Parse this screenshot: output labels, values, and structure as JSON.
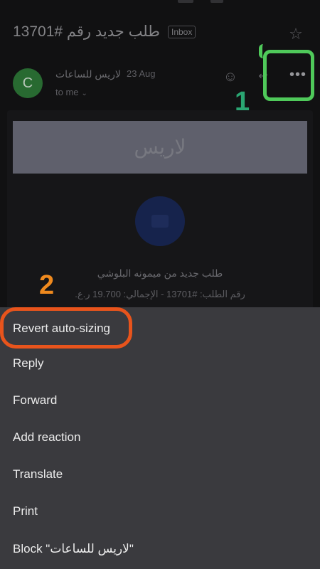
{
  "email": {
    "subject": "طلب جديد رقم #13701",
    "folder_chip": "Inbox",
    "sender": {
      "avatar_letter": "C",
      "name": "لاريس للساعات",
      "date": "23 Aug",
      "to": "to me"
    },
    "body": {
      "banner_text": "لاريس",
      "line1": "طلب جديد من ميمونه البلوشي",
      "line2": "رقم الطلب: #13701 - الإجمالي: 19.700 ر.ع."
    }
  },
  "annotations": {
    "label_1": "1",
    "label_2": "2",
    "green_color": "#4fc95a",
    "orange_color": "#e8541c"
  },
  "menu": {
    "items": [
      "Revert auto-sizing",
      "Reply",
      "Forward",
      "Add reaction",
      "Translate",
      "Print",
      "Block \"لاريس للساعات\""
    ]
  },
  "icons": {
    "star": "star-icon",
    "emoji": "emoji-icon",
    "reply": "reply-icon",
    "more": "more-options-icon"
  }
}
